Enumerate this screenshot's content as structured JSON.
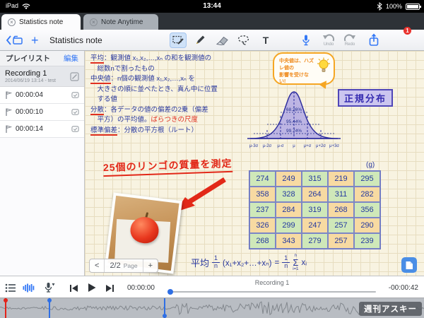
{
  "status_bar": {
    "carrier": "iPad",
    "time": "13:44",
    "battery": "100%"
  },
  "tab_strip": {
    "close_glyph": "×",
    "tabs": [
      {
        "label": "Statistics note"
      },
      {
        "label": "Note Anytime"
      }
    ]
  },
  "toolbar": {
    "title": "Statistics note",
    "add_label": "+",
    "text_tool": "T",
    "undo_label": "Undo",
    "redo_label": "Redo",
    "notes_badge": "1"
  },
  "sidebar": {
    "header": "プレイリスト",
    "edit": "編集",
    "recording": {
      "title": "Recording 1",
      "subtitle": "2014/06/19 13:14 - test"
    },
    "markers": [
      "00:00:04",
      "00:00:10",
      "00:00:14"
    ]
  },
  "canvas": {
    "notes": [
      [
        {
          "t": "平均",
          "s": "u"
        },
        {
          "t": "：観測値 x₁,x₂,…,xₙ の和を観測値の"
        }
      ],
      [
        {
          "t": "　総数nで割ったもの"
        }
      ],
      [
        {
          "t": "中央値",
          "s": "u"
        },
        {
          "t": "：n個の観測値 x₁,x₂,…,xₙ を"
        }
      ],
      [
        {
          "t": "　大きさの順に並べたとき、真ん中に位置"
        }
      ],
      [
        {
          "t": "　する値"
        }
      ],
      [
        {
          "t": "分散",
          "s": "u"
        },
        {
          "t": "：各データの値の偏差の2乗（偏差"
        }
      ],
      [
        {
          "t": "　平方）の平均値。"
        },
        {
          "t": "ばらつきの尺度",
          "s": "r"
        }
      ],
      [
        {
          "t": "標準偏差",
          "s": "u"
        },
        {
          "t": "：分散の平方根（ルート）"
        }
      ]
    ],
    "red_note": "25個のリンゴの質量を測定",
    "bubble_line1": "中央値は、ハズレ値の",
    "bubble_line2": "影響を受けない!",
    "normal": {
      "title": "正規分布",
      "pct1": "68.26%",
      "pct2": "95.44%",
      "pct3": "99.74%",
      "axis": [
        "μ-3σ",
        "μ-2σ",
        "μ-σ",
        "μ",
        "μ+σ",
        "μ+2σ",
        "μ+3σ"
      ]
    },
    "table": {
      "unit": "(g)",
      "rows": [
        [
          "274",
          "249",
          "315",
          "219",
          "295"
        ],
        [
          "358",
          "328",
          "264",
          "311",
          "282"
        ],
        [
          "237",
          "284",
          "319",
          "268",
          "356"
        ],
        [
          "326",
          "299",
          "247",
          "257",
          "290"
        ],
        [
          "268",
          "343",
          "279",
          "257",
          "239"
        ]
      ]
    },
    "formula": {
      "label": "平均",
      "f1n": "1",
      "f1d": "n",
      "body": "(x₁+x₂+…+xₙ)",
      "eq": "=",
      "f2n": "1",
      "f2d": "n",
      "sig_top": "n",
      "sig": "Σ",
      "sig_bot": "i=1",
      "xi": "xᵢ"
    },
    "page_nav": {
      "prev": "<",
      "page": "2/2",
      "label": "Page",
      "add": "+"
    }
  },
  "audio_bar": {
    "elapsed": "00:00:00",
    "track": "Recording 1",
    "remaining": "-00:00:42"
  },
  "watermark": "週刊アスキー"
}
